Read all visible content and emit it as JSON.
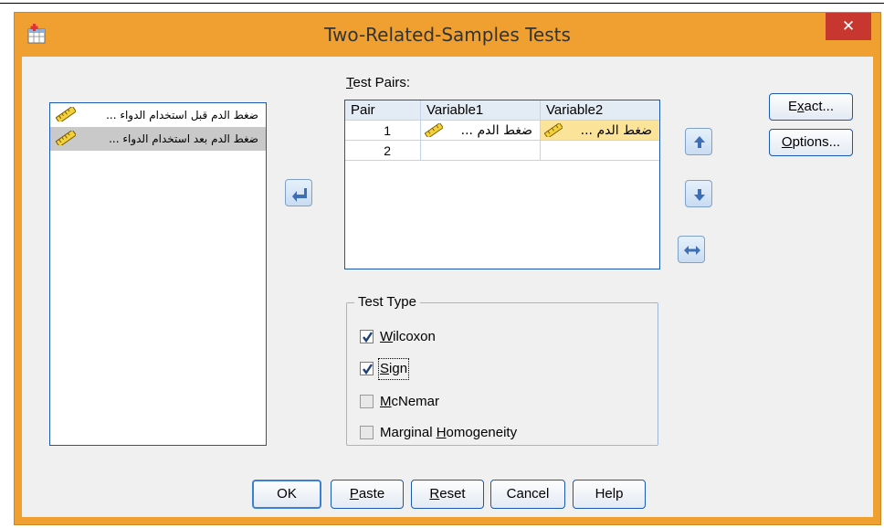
{
  "window": {
    "title": "Two-Related-Samples Tests",
    "close_glyph": "✕"
  },
  "variables": [
    {
      "label": "ضغط الدم قبل استخدام الدواء ...",
      "icon": "ruler-scale-icon",
      "selected": false
    },
    {
      "label": "ضغط الدم بعد استخدام الدواء ...",
      "icon": "ruler-scale-icon",
      "selected": true
    }
  ],
  "test_pairs": {
    "label_prefix": "",
    "label_mnemonic": "T",
    "label_rest": "est Pairs:",
    "columns": [
      "Pair",
      "Variable1",
      "Variable2"
    ],
    "rows": [
      {
        "pair": "1",
        "var1": "ضغط الدم ...",
        "var2": "ضغط الدم ..."
      },
      {
        "pair": "2",
        "var1": "",
        "var2": ""
      }
    ]
  },
  "test_type": {
    "title": "Test Type",
    "options": [
      {
        "pre": "",
        "mn": "W",
        "post": "ilcoxon",
        "checked": true
      },
      {
        "pre": "",
        "mn": "S",
        "post": "ign",
        "checked": true
      },
      {
        "pre": "",
        "mn": "M",
        "post": "cNemar",
        "checked": false
      },
      {
        "pre": "Marginal ",
        "mn": "H",
        "post": "omogeneity",
        "checked": false
      }
    ]
  },
  "side_buttons": {
    "exact": {
      "pre": "E",
      "mn": "x",
      "post": "act..."
    },
    "options": {
      "pre": "",
      "mn": "O",
      "post": "ptions..."
    }
  },
  "bottom_buttons": {
    "ok": "OK",
    "paste": {
      "mn": "P",
      "post": "aste"
    },
    "reset": {
      "mn": "R",
      "post": "eset"
    },
    "cancel": "Cancel",
    "help": "Help"
  },
  "colors": {
    "titlebar": "#f0a030",
    "close": "#c7372f",
    "list_border": "#1c57b2",
    "highlight": "#fbe39a",
    "arrow_blue": "#3d6fb6"
  }
}
